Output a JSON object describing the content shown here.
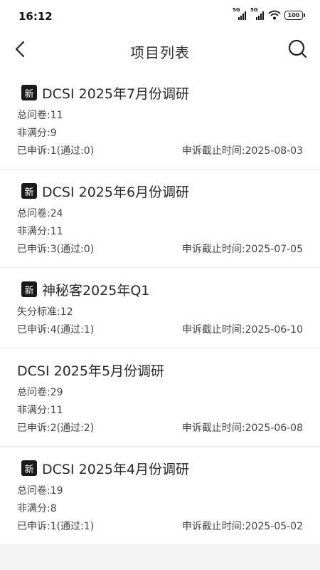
{
  "status_bar": {
    "time": "16:12",
    "signal_1": "5G",
    "signal_2": "5G",
    "battery": "100"
  },
  "nav": {
    "title": "项目列表"
  },
  "projects": [
    {
      "is_new": true,
      "new_label": "新",
      "title": "DCSI 2025年7月份调研",
      "stats": [
        "总问卷:11",
        "非满分:9"
      ],
      "appeal": "已申诉:1(通过:0)",
      "deadline": "申诉截止时间:2025-08-03"
    },
    {
      "is_new": true,
      "new_label": "新",
      "title": "DCSI 2025年6月份调研",
      "stats": [
        "总问卷:24",
        "非满分:11"
      ],
      "appeal": "已申诉:3(通过:0)",
      "deadline": "申诉截止时间:2025-07-05"
    },
    {
      "is_new": true,
      "new_label": "新",
      "title": "神秘客2025年Q1",
      "stats": [
        "失分标准:12"
      ],
      "appeal": "已申诉:4(通过:1)",
      "deadline": "申诉截止时间:2025-06-10"
    },
    {
      "is_new": false,
      "new_label": "",
      "title": "DCSI 2025年5月份调研",
      "stats": [
        "总问卷:29",
        "非满分:11"
      ],
      "appeal": "已申诉:2(通过:2)",
      "deadline": "申诉截止时间:2025-06-08"
    },
    {
      "is_new": true,
      "new_label": "新",
      "title": "DCSI 2025年4月份调研",
      "stats": [
        "总问卷:19",
        "非满分:8"
      ],
      "appeal": "已申诉:1(通过:1)",
      "deadline": "申诉截止时间:2025-05-02"
    }
  ]
}
